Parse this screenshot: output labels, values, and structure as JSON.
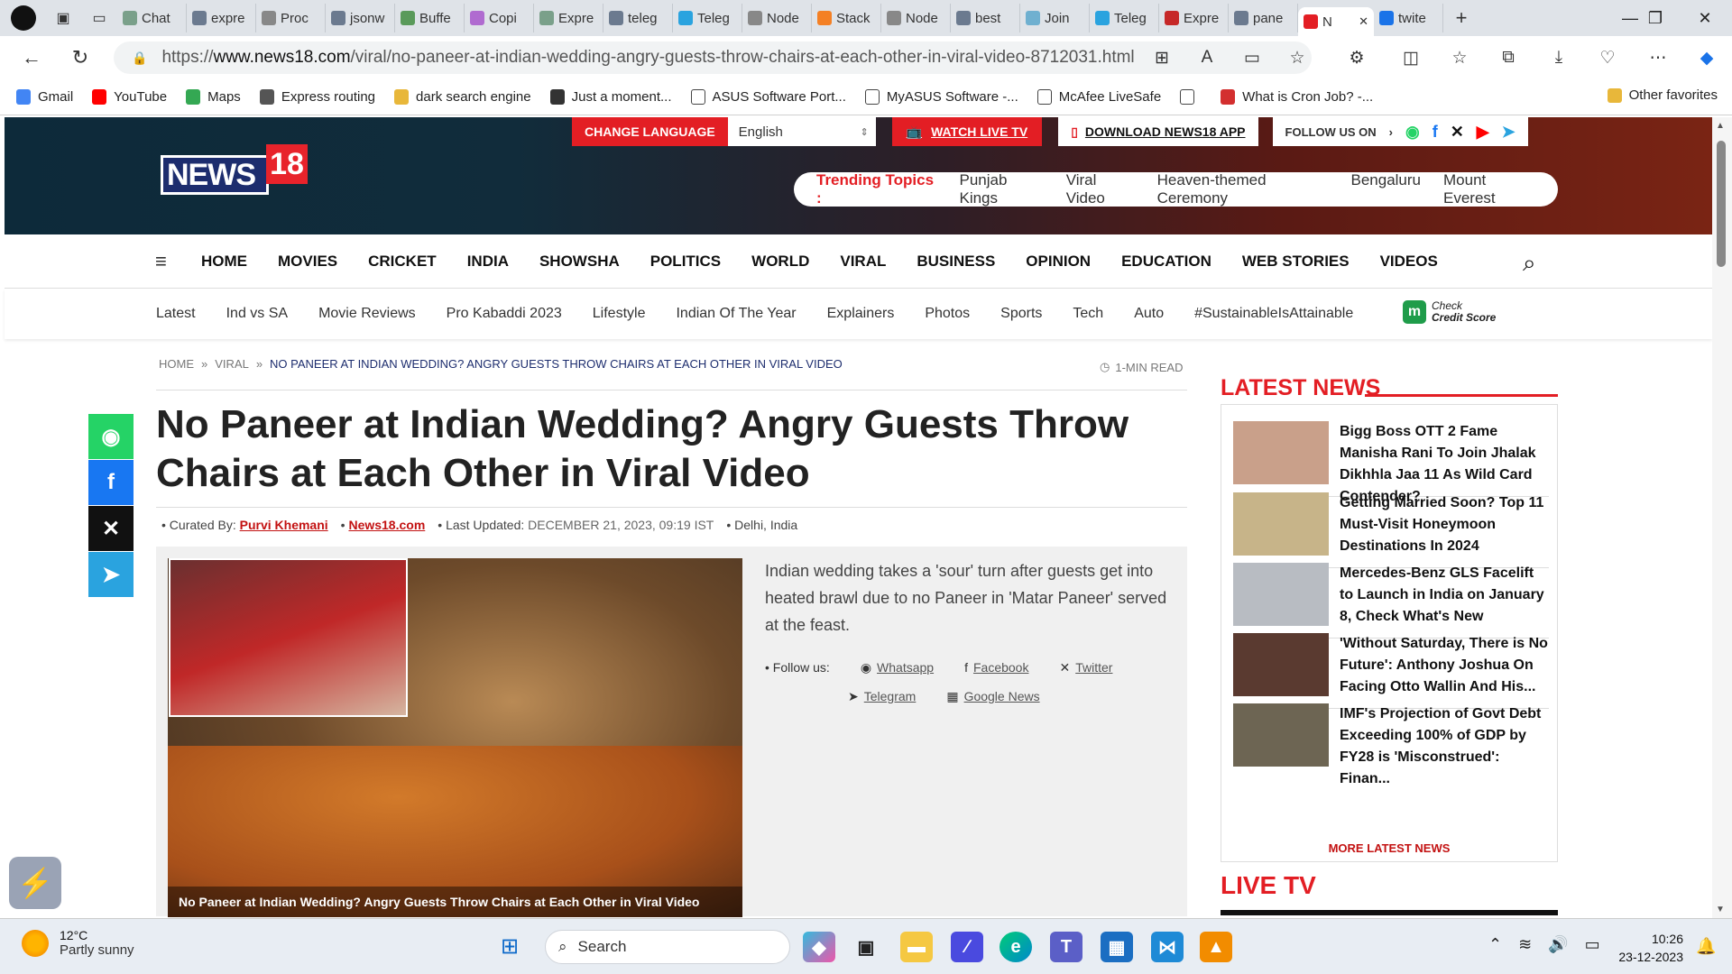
{
  "browser": {
    "tabs": [
      {
        "label": "Chat",
        "icon": "chatgpt-icon",
        "color": "#7aa08a"
      },
      {
        "label": "expre",
        "icon": "search-icon",
        "color": "#6b7a8f"
      },
      {
        "label": "Proc",
        "icon": "express-icon",
        "color": "#888888"
      },
      {
        "label": "jsonw",
        "icon": "search-icon",
        "color": "#6b7a8f"
      },
      {
        "label": "Buffe",
        "icon": "node-icon",
        "color": "#5a9a5a"
      },
      {
        "label": "Copi",
        "icon": "copilot-icon",
        "color": "#b06bd0"
      },
      {
        "label": "Expre",
        "icon": "chatgpt-icon",
        "color": "#7aa08a"
      },
      {
        "label": "teleg",
        "icon": "search-icon",
        "color": "#6b7a8f"
      },
      {
        "label": "Teleg",
        "icon": "telegram-icon",
        "color": "#2aa3df"
      },
      {
        "label": "Node",
        "icon": "t-icon",
        "color": "#888888"
      },
      {
        "label": "Stack",
        "icon": "stackoverflow-icon",
        "color": "#f48024"
      },
      {
        "label": "Node",
        "icon": "t-icon",
        "color": "#888888"
      },
      {
        "label": "best",
        "icon": "search-icon",
        "color": "#6b7a8f"
      },
      {
        "label": "Join",
        "icon": "cloud-icon",
        "color": "#6fb0d0"
      },
      {
        "label": "Teleg",
        "icon": "telegram-icon",
        "color": "#2aa3df"
      },
      {
        "label": "Expre",
        "icon": "pdf-icon",
        "color": "#c62828"
      },
      {
        "label": "pane",
        "icon": "search-icon",
        "color": "#6b7a8f"
      },
      {
        "label": "N",
        "icon": "news18-icon",
        "color": "#e31e24",
        "active": true
      },
      {
        "label": "twite",
        "icon": "search-icon",
        "color": "#1a73e8"
      }
    ],
    "url_prefix": "https://",
    "url_domain": "www.news18.com",
    "url_path": "/viral/no-paneer-at-indian-wedding-angry-guests-throw-chairs-at-each-other-in-viral-video-8712031.html",
    "bookmarks": [
      {
        "label": "Gmail",
        "icon": "google-icon",
        "color": "#4285f4"
      },
      {
        "label": "YouTube",
        "icon": "youtube-icon",
        "color": "#ff0000"
      },
      {
        "label": "Maps",
        "icon": "maps-icon",
        "color": "#34a853"
      },
      {
        "label": "Express routing",
        "icon": "express-icon",
        "color": "#555555"
      },
      {
        "label": "dark search engine",
        "icon": "folder-icon",
        "color": "#e8b73a"
      },
      {
        "label": "Just a moment...",
        "icon": "app-icon",
        "color": "#333333"
      },
      {
        "label": "ASUS Software Port...",
        "icon": "page-icon",
        "color": "#ffffff"
      },
      {
        "label": "MyASUS Software -...",
        "icon": "page-icon",
        "color": "#ffffff"
      },
      {
        "label": "McAfee LiveSafe",
        "icon": "page-icon",
        "color": "#ffffff"
      },
      {
        "label": "",
        "icon": "page-icon",
        "color": "#ffffff"
      },
      {
        "label": "What is Cron Job? -...",
        "icon": "cron-icon",
        "color": "#d32f2f"
      }
    ],
    "other_favorites": "Other favorites"
  },
  "site": {
    "logo_text": "NEWS",
    "logo_num": "18",
    "change_language": "CHANGE LANGUAGE",
    "language": "English",
    "watch_live": "WATCH LIVE TV",
    "download_app": "DOWNLOAD NEWS18 APP",
    "follow_us": "FOLLOW US ON",
    "trending_label": "Trending Topics :",
    "trending": [
      "Punjab Kings",
      "Viral Video",
      "Heaven-themed Ceremony",
      "Bengaluru",
      "Mount Everest"
    ],
    "nav": [
      "HOME",
      "MOVIES",
      "CRICKET",
      "INDIA",
      "SHOWSHA",
      "POLITICS",
      "WORLD",
      "VIRAL",
      "BUSINESS",
      "OPINION",
      "EDUCATION",
      "WEB STORIES",
      "VIDEOS"
    ],
    "subnav": [
      "Latest",
      "Ind vs SA",
      "Movie Reviews",
      "Pro Kabaddi 2023",
      "Lifestyle",
      "Indian Of The Year",
      "Explainers",
      "Photos",
      "Sports",
      "Tech",
      "Auto",
      "#SustainableIsAttainable"
    ],
    "credit_line1": "Check",
    "credit_line2": "Credit Score"
  },
  "article": {
    "breadcrumb": [
      "HOME",
      "VIRAL",
      "NO PANEER AT INDIAN WEDDING? ANGRY GUESTS THROW CHAIRS AT EACH OTHER IN VIRAL VIDEO"
    ],
    "read_time": "1-MIN READ",
    "title": "No Paneer at Indian Wedding? Angry Guests Throw Chairs at Each Other in Viral Video",
    "curated_label": "Curated By:",
    "author": "Purvi Khemani",
    "source": "News18.com",
    "updated_label": "Last Updated:",
    "updated": "DECEMBER 21, 2023, 09:19 IST",
    "location": "Delhi, India",
    "image_caption": "No Paneer at Indian Wedding? Angry Guests Throw Chairs at Each Other in Viral Video",
    "description": "Indian wedding takes a 'sour' turn after guests get into heated brawl due to no Paneer in 'Matar Paneer' served at the feast.",
    "follow_label": "Follow us:",
    "follow_links": [
      "Whatsapp",
      "Facebook",
      "Twitter",
      "Telegram",
      "Google News"
    ]
  },
  "sidebar": {
    "latest_title": "LATEST NEWS",
    "items": [
      {
        "text": "Bigg Boss OTT 2 Fame Manisha Rani To Join Jhalak Dikhhla Jaa 11 As Wild Card Contender?",
        "thumb": "#c9a08a"
      },
      {
        "text": "Getting Married Soon? Top 11 Must-Visit Honeymoon Destinations In 2024",
        "thumb": "#c7b489"
      },
      {
        "text": "Mercedes-Benz GLS Facelift to Launch in India on January 8, Check What's New",
        "thumb": "#b8bcc2"
      },
      {
        "text": "'Without Saturday, There is No Future': Anthony Joshua On Facing Otto Wallin And His...",
        "thumb": "#5a3a30"
      },
      {
        "text": "IMF's Projection of Govt Debt Exceeding 100% of GDP by FY28 is 'Misconstrued': Finan...",
        "thumb": "#6d6553"
      }
    ],
    "more": "MORE LATEST NEWS",
    "live_tv": "LIVE TV"
  },
  "taskbar": {
    "temp": "12°C",
    "weather": "Partly sunny",
    "search": "Search",
    "time": "10:26",
    "date": "23-12-2023"
  }
}
